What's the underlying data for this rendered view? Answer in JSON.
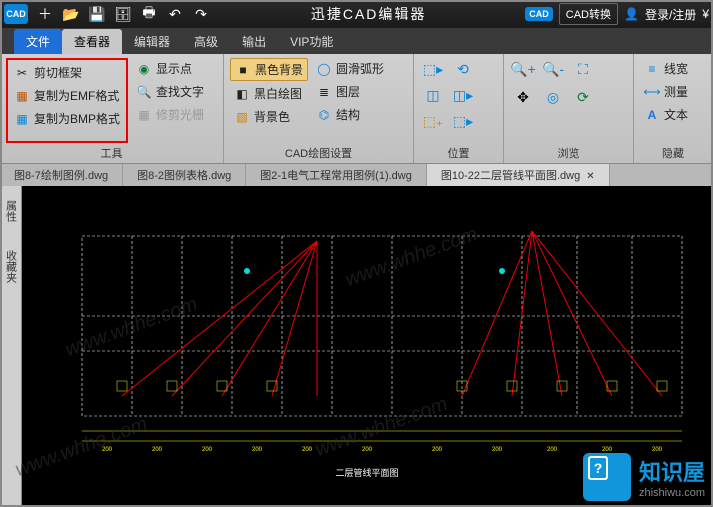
{
  "titlebar": {
    "logo": "CAD",
    "title": "迅捷CAD编辑器",
    "cad_badge": "CAD",
    "convert": "CAD转换",
    "login": "登录/注册",
    "currency": "¥"
  },
  "tabs": {
    "file": "文件",
    "viewer": "查看器",
    "editor": "编辑器",
    "advanced": "高级",
    "output": "输出",
    "vip": "VIP功能"
  },
  "ribbon": {
    "tools": {
      "label": "工具",
      "cut_frame": "剪切框架",
      "copy_emf": "复制为EMF格式",
      "copy_bmp": "复制为BMP格式",
      "show_point": "显示点",
      "find_text": "查找文字",
      "trim_raster": "修剪光栅"
    },
    "cad_draw": {
      "label": "CAD绘图设置",
      "black_bg": "黑色背景",
      "bw_draw": "黑白绘图",
      "bg_color": "背景色",
      "smooth_arc": "圆滑弧形",
      "layers": "图层",
      "structure": "结构"
    },
    "position": {
      "label": "位置"
    },
    "browse": {
      "label": "浏览",
      "line_width": "线宽",
      "measure": "测量",
      "text": "文本"
    },
    "hide": {
      "label": "隐藏"
    }
  },
  "doctabs": {
    "t1": "图8-7绘制图例.dwg",
    "t2": "图8-2图例表格.dwg",
    "t3": "图2-1电气工程常用图例(1).dwg",
    "t4": "图10-22二层管线平面图.dwg"
  },
  "sidepanel": {
    "props": "属性",
    "fav": "收藏夹"
  },
  "canvas": {
    "drawing_title": "二层管线平面图"
  },
  "brand": {
    "name": "知识屋",
    "domain": "zhishiwu.com"
  },
  "watermarks": [
    "www.whhe.com",
    "www.whhe.com",
    "www.whhe.com",
    "www.whhe.com"
  ]
}
